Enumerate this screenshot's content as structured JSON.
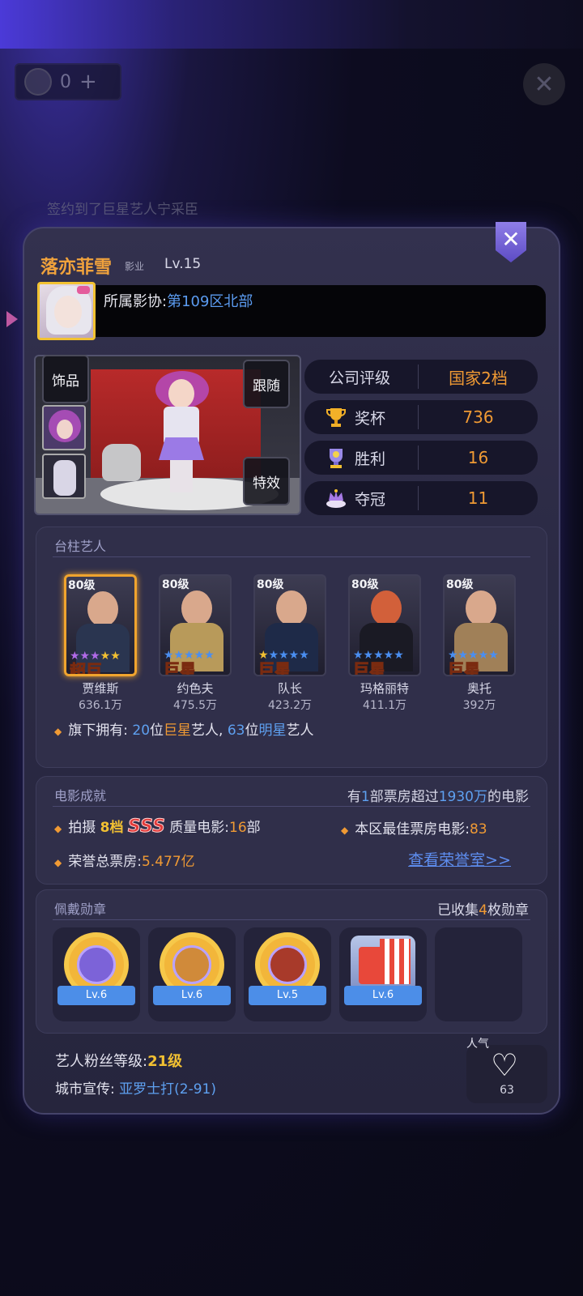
{
  "top": {
    "coin_value": "0",
    "coin_plus": "+",
    "close_label": "✕",
    "marquee": "签约到了巨星艺人宁采臣"
  },
  "profile": {
    "name": "落亦菲雪",
    "tag": "影业",
    "level": "Lv.15",
    "guild_label": "所属影协:",
    "guild_value": "第109区北部",
    "close_label": "✕"
  },
  "stage": {
    "accessory_label": "饰品",
    "follow_label": "跟随",
    "effect_label": "特效"
  },
  "stats": [
    {
      "label": "公司评级",
      "value": "国家2档",
      "icon": ""
    },
    {
      "label": "奖杯",
      "value": "736",
      "icon": "trophy-icon"
    },
    {
      "label": "胜利",
      "value": "16",
      "icon": "victory-icon"
    },
    {
      "label": "夺冠",
      "value": "11",
      "icon": "crown-icon"
    }
  ],
  "pillar": {
    "title": "台柱艺人",
    "artists": [
      {
        "level": "80级",
        "rank": "超巨",
        "name": "贾维斯",
        "fans": "636.1万",
        "body_color": "#2a3550",
        "stars": "★★★★★"
      },
      {
        "level": "80级",
        "rank": "巨星",
        "name": "约色夫",
        "fans": "475.5万",
        "body_color": "#b89a5a",
        "stars": "★★★★★"
      },
      {
        "level": "80级",
        "rank": "巨星",
        "name": "队长",
        "fans": "423.2万",
        "body_color": "#1e2a48",
        "stars": "★★★★★"
      },
      {
        "level": "80级",
        "rank": "巨星",
        "name": "玛格丽特",
        "fans": "411.1万",
        "body_color": "#1a1a24",
        "stars": "★★★★★"
      },
      {
        "level": "80级",
        "rank": "巨星",
        "name": "奥托",
        "fans": "392万",
        "body_color": "#a08058",
        "stars": "★★★★★"
      }
    ],
    "own_prefix": "旗下拥有:",
    "own_count1": "20",
    "own_unit1": "位",
    "own_type1": "巨星",
    "own_mid": "艺人,",
    "own_count2": "63",
    "own_unit2": "位",
    "own_type2": "明星",
    "own_suffix": "艺人"
  },
  "movie": {
    "title": "电影成就",
    "right_prefix": "有",
    "right_count": "1",
    "right_mid": "部票房超过",
    "right_amount": "1930万",
    "right_suffix": "的电影",
    "shoot_label": "拍摄",
    "shoot_tier": "8档",
    "shoot_sss": "SSS",
    "shoot_mid": "质量电影:",
    "shoot_count": "16",
    "shoot_unit": "部",
    "best_label": "本区最佳票房电影:",
    "best_value": "83",
    "honor_label": "荣誉总票房:",
    "honor_value": "5.477亿",
    "honor_link": "查看荣誉室>>"
  },
  "medals": {
    "title": "佩戴勋章",
    "right_prefix": "已收集",
    "right_count": "4",
    "right_suffix": "枚勋章",
    "items": [
      {
        "level": "Lv.6",
        "icon": "ufo-medal-icon"
      },
      {
        "level": "Lv.6",
        "icon": "soldier-medal-icon"
      },
      {
        "level": "Lv.5",
        "icon": "silhouette-medal-icon"
      },
      {
        "level": "Lv.6",
        "icon": "popcorn-medal-icon"
      }
    ]
  },
  "footer": {
    "fan_label": "艺人粉丝等级:",
    "fan_value": "21级",
    "city_label": "城市宣传:",
    "city_value": "亚罗士打(2-91)",
    "pop_label": "人气",
    "pop_value": "63"
  }
}
